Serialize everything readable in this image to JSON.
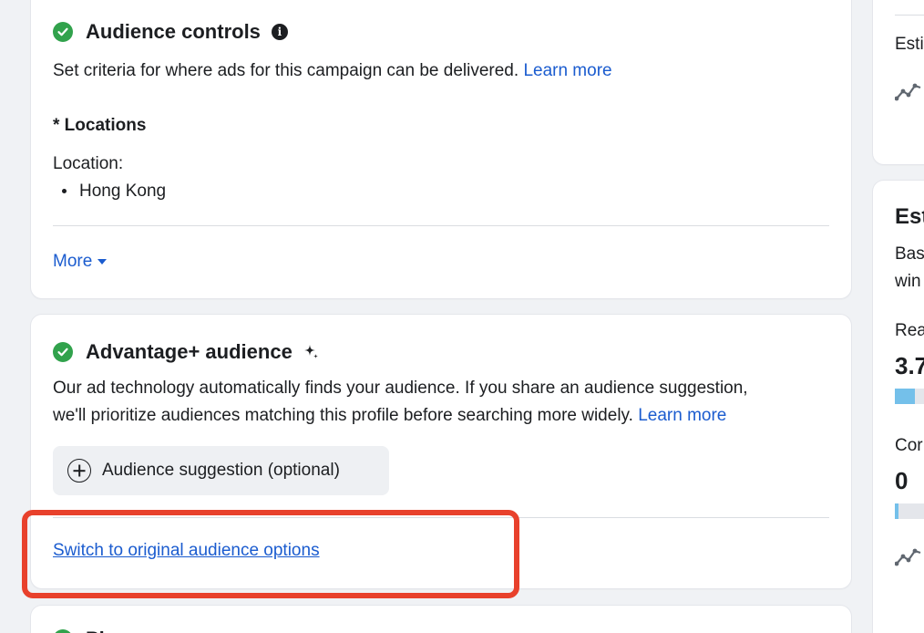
{
  "audience_controls": {
    "title": "Audience controls",
    "description": "Set criteria for where ads for this campaign can be delivered.",
    "learn_more": "Learn more",
    "locations_heading": "* Locations",
    "location_label": "Location:",
    "locations": [
      "Hong Kong"
    ],
    "more_label": "More"
  },
  "advantage_audience": {
    "title": "Advantage+ audience",
    "description_line1": "Our ad technology automatically finds your audience. If you share an audience suggestion,",
    "description_line2": "we'll prioritize audiences matching this profile before searching more widely.",
    "learn_more": "Learn more",
    "suggestion_button": "Audience suggestion (optional)",
    "switch_link": "Switch to original audience options"
  },
  "next_section": {
    "title_partial": "Pl"
  },
  "sidebar": {
    "estimate_top": "Esti",
    "estimate_title": "Est",
    "based_line1": "Bas",
    "based_line2": "win",
    "reach_label": "Rea",
    "reach_value": "3.7",
    "reach_bar_fill": 0.55,
    "conversions_label": "Cor",
    "conversions_value": "0",
    "conversions_bar_fill": 0.1
  },
  "colors": {
    "link": "#1b5ccf",
    "success": "#31a24c",
    "highlight": "#e8412c",
    "bar": "#74c0ea"
  }
}
